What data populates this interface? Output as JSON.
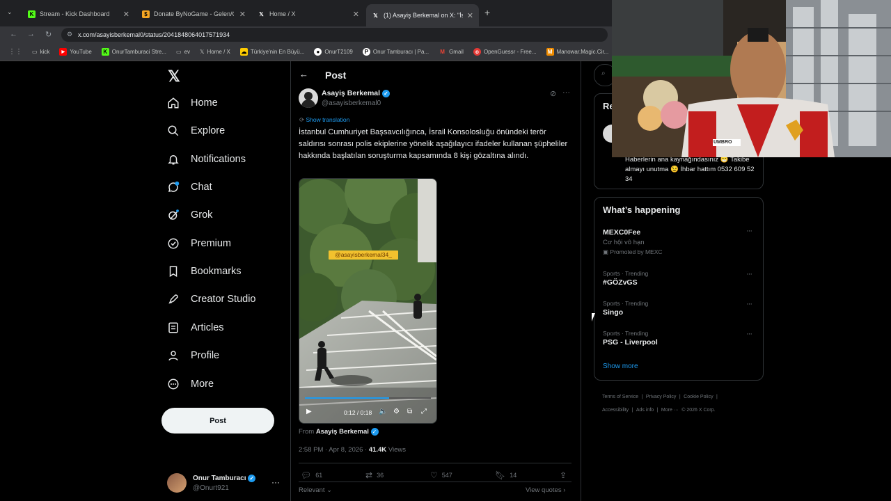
{
  "browser": {
    "tabs": [
      {
        "title": "Stream - Kick Dashboard",
        "favicon": "K",
        "color": "#53fc18"
      },
      {
        "title": "Donate ByNoGame - Gelen/Gid...",
        "favicon": "$",
        "color": "#f5a623"
      },
      {
        "title": "Home / X",
        "favicon": "X",
        "color": "#ffffff"
      },
      {
        "title": "(1) Asayiş Berkemal on X: \"İstan...",
        "favicon": "X",
        "color": "#ffffff"
      }
    ],
    "url": "x.com/asayisberkemal0/status/2041848064017571934",
    "bookmarks": [
      "kick",
      "YouTube",
      "OnurTamburaci Stre...",
      "ev",
      "Home / X",
      "Türkiye'nin En Büyü...",
      "OnurT2109",
      "Onur Tamburacı | Pa...",
      "Gmail",
      "OpenGuessr - Free...",
      "Manowar.Magic.Cir..."
    ]
  },
  "nav": {
    "items": [
      "Home",
      "Explore",
      "Notifications",
      "Chat",
      "Grok",
      "Premium",
      "Bookmarks",
      "Creator Studio",
      "Articles",
      "Profile",
      "More"
    ],
    "post_label": "Post",
    "account": {
      "name": "Onur Tamburacı",
      "handle": "@Onurt921"
    }
  },
  "post": {
    "header_title": "Post",
    "author": "Asayiş Berkemal",
    "handle": "@asayisberkemal0",
    "show_translation": "Show translation",
    "text": "İstanbul Cumhuriyet Başsavcılığınca, İsrail Konsolosluğu önündeki terör saldırısı sonrası polis ekiplerine yönelik aşağılayıcı ifadeler kullanan şüpheliler hakkında başlatılan soruşturma kapsamında 8 kişi gözaltına alındı.",
    "video": {
      "watermark": "@asayisberkemal34_",
      "time": "0:12 / 0:18",
      "progress": 0.67
    },
    "from_label": "From",
    "from_name": "Asayiş Berkemal",
    "timestamp": "2:58 PM · Apr 8, 2026 ·",
    "views_count": "41.4K",
    "views_label": "Views",
    "replies": "61",
    "reposts": "36",
    "likes": "547",
    "bookmarks": "14",
    "relevant": "Relevant",
    "view_quotes": "View quotes"
  },
  "right": {
    "partial_heading": "Re",
    "promo_text": "Haberlerin ana kaynağındasınız 😁 Takibe almayı unutma 😉 İhbar hattım 0532 609 52 34",
    "whats_happening": "What’s happening",
    "trends": [
      {
        "meta": "",
        "name": "MEXC0Fee",
        "sub": "Cơ hội vô hạn",
        "promo": "Promoted by MEXC"
      },
      {
        "meta": "Sports · Trending",
        "name": "#GÖZvGS"
      },
      {
        "meta": "Sports · Trending",
        "name": "Singo"
      },
      {
        "meta": "Sports · Trending",
        "name": "PSG - Liverpool"
      }
    ],
    "show_more": "Show more",
    "footer": [
      "Terms of Service",
      "Privacy Policy",
      "Cookie Policy",
      "Accessibility",
      "Ads info",
      "More ···",
      "© 2026 X Corp."
    ]
  },
  "webcam": {
    "shirt_text": "UMBRO"
  }
}
